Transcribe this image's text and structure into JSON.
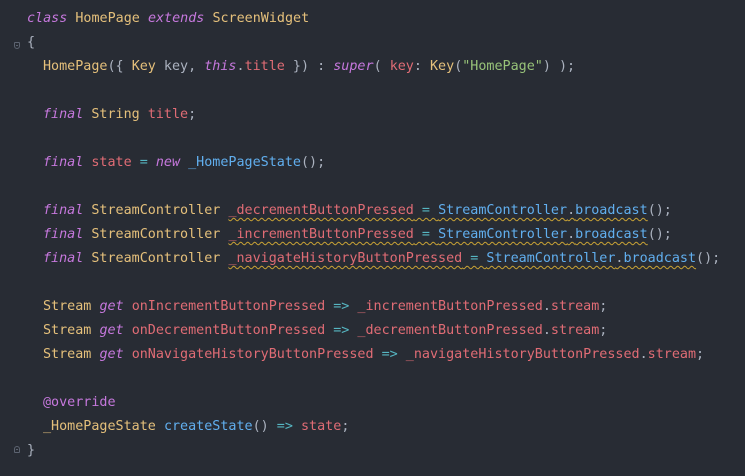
{
  "code": {
    "line1": {
      "kw_class": "class",
      "name": "HomePage",
      "kw_extends": "extends",
      "base": "ScreenWidget"
    },
    "line2": {
      "brace": "{"
    },
    "line3": {
      "ctor": "HomePage",
      "p1": "({ ",
      "type_key": "Key",
      "p2": " key, ",
      "kw_this": "this",
      "p3": ".",
      "field_title": "title",
      "p4": " }) : ",
      "kw_super": "super",
      "p5": "( ",
      "named_key": "key",
      "p6": ": ",
      "key_call": "Key",
      "p7": "(",
      "str": "\"HomePage\"",
      "p8": ") );"
    },
    "line5": {
      "kw_final": "final",
      "type": "String",
      "name": "title",
      "end": ";"
    },
    "line7": {
      "kw_final": "final",
      "name": "state",
      "eq": " = ",
      "kw_new": "new",
      "cls": "_HomePageState",
      "end": "();"
    },
    "line9": {
      "kw_final": "final",
      "type": "StreamController",
      "name": "_decrementButtonPressed",
      "eq": " = ",
      "cls": "StreamController",
      "dot": ".",
      "method": "broadcast",
      "end": "();"
    },
    "line10": {
      "kw_final": "final",
      "type": "StreamController",
      "name": "_incrementButtonPressed",
      "eq": " = ",
      "cls": "StreamController",
      "dot": ".",
      "method": "broadcast",
      "end": "();"
    },
    "line11": {
      "kw_final": "final",
      "type": "StreamController",
      "name": "_navigateHistoryButtonPressed",
      "eq": " = ",
      "cls": "StreamController",
      "dot": ".",
      "method": "broadcast",
      "end": "();"
    },
    "line13": {
      "type": "Stream",
      "kw_get": "get",
      "name": "onIncrementButtonPressed",
      "arrow": " => ",
      "target": "_incrementButtonPressed",
      "dot": ".",
      "prop": "stream",
      "end": ";"
    },
    "line14": {
      "type": "Stream",
      "kw_get": "get",
      "name": "onDecrementButtonPressed",
      "arrow": " => ",
      "target": "_decrementButtonPressed",
      "dot": ".",
      "prop": "stream",
      "end": ";"
    },
    "line15": {
      "type": "Stream",
      "kw_get": "get",
      "name": "onNavigateHistoryButtonPressed",
      "arrow": " => ",
      "target": "_navigateHistoryButtonPressed",
      "dot": ".",
      "prop": "stream",
      "end": ";"
    },
    "line17": {
      "annotation": "@override"
    },
    "line18": {
      "type": "_HomePageState",
      "method": "createState",
      "paren": "()",
      "arrow": " => ",
      "ret": "state",
      "end": ";"
    },
    "line19": {
      "brace": "}"
    }
  },
  "colors": {
    "background": "#282c34",
    "keyword": "#c678dd",
    "type": "#e5c07b",
    "function": "#61afef",
    "identifier": "#e06c75",
    "string": "#98c379",
    "operator": "#56b6c2"
  }
}
